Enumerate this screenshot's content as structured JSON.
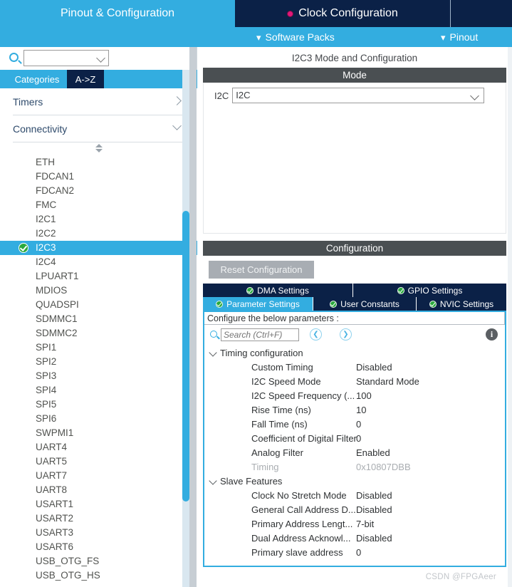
{
  "header": {
    "tabs": [
      {
        "label": "Pinout & Configuration",
        "active": true,
        "has_error_dot": false
      },
      {
        "label": "Clock Configuration",
        "active": false,
        "has_error_dot": true
      }
    ],
    "subbar": [
      {
        "label": "Software Packs",
        "icon": "chevron-down-icon"
      },
      {
        "label": "Pinout",
        "icon": "chevron-down-icon"
      }
    ],
    "colors": {
      "active_tab": "#33ade0",
      "inactive_tab": "#0b2147",
      "error_dot": "#e0187a"
    }
  },
  "sidebar": {
    "search": {
      "value": "",
      "placeholder": "",
      "icon": "search-icon"
    },
    "settings_icon": "gear-icon",
    "category_tabs": [
      {
        "label": "Categories",
        "active": true
      },
      {
        "label": "A->Z",
        "active": false
      }
    ],
    "groups": [
      {
        "label": "Timers",
        "expanded": false,
        "icon": "chevron-right-icon"
      },
      {
        "label": "Connectivity",
        "expanded": true,
        "icon": "chevron-down-icon"
      }
    ],
    "peripherals": [
      {
        "label": "ETH",
        "selected": false,
        "configured": false
      },
      {
        "label": "FDCAN1",
        "selected": false,
        "configured": false
      },
      {
        "label": "FDCAN2",
        "selected": false,
        "configured": false
      },
      {
        "label": "FMC",
        "selected": false,
        "configured": false
      },
      {
        "label": "I2C1",
        "selected": false,
        "configured": false
      },
      {
        "label": "I2C2",
        "selected": false,
        "configured": false
      },
      {
        "label": "I2C3",
        "selected": true,
        "configured": true
      },
      {
        "label": "I2C4",
        "selected": false,
        "configured": false
      },
      {
        "label": "LPUART1",
        "selected": false,
        "configured": false
      },
      {
        "label": "MDIOS",
        "selected": false,
        "configured": false
      },
      {
        "label": "QUADSPI",
        "selected": false,
        "configured": false
      },
      {
        "label": "SDMMC1",
        "selected": false,
        "configured": false
      },
      {
        "label": "SDMMC2",
        "selected": false,
        "configured": false
      },
      {
        "label": "SPI1",
        "selected": false,
        "configured": false
      },
      {
        "label": "SPI2",
        "selected": false,
        "configured": false
      },
      {
        "label": "SPI3",
        "selected": false,
        "configured": false
      },
      {
        "label": "SPI4",
        "selected": false,
        "configured": false
      },
      {
        "label": "SPI5",
        "selected": false,
        "configured": false
      },
      {
        "label": "SPI6",
        "selected": false,
        "configured": false
      },
      {
        "label": "SWPMI1",
        "selected": false,
        "configured": false
      },
      {
        "label": "UART4",
        "selected": false,
        "configured": false
      },
      {
        "label": "UART5",
        "selected": false,
        "configured": false
      },
      {
        "label": "UART7",
        "selected": false,
        "configured": false
      },
      {
        "label": "UART8",
        "selected": false,
        "configured": false
      },
      {
        "label": "USART1",
        "selected": false,
        "configured": false
      },
      {
        "label": "USART2",
        "selected": false,
        "configured": false
      },
      {
        "label": "USART3",
        "selected": false,
        "configured": false
      },
      {
        "label": "USART6",
        "selected": false,
        "configured": false
      },
      {
        "label": "USB_OTG_FS",
        "selected": false,
        "configured": false
      },
      {
        "label": "USB_OTG_HS",
        "selected": false,
        "configured": false
      }
    ]
  },
  "main": {
    "title": "I2C3 Mode and Configuration",
    "mode": {
      "header": "Mode",
      "field_label": "I2C",
      "selected_value": "I2C"
    },
    "configuration": {
      "header": "Configuration",
      "reset_button": "Reset Configuration",
      "tabs_row1": [
        {
          "label": "DMA Settings",
          "active": false,
          "icon": "check-circle-icon"
        },
        {
          "label": "GPIO Settings",
          "active": false,
          "icon": "check-circle-icon"
        }
      ],
      "tabs_row2": [
        {
          "label": "Parameter Settings",
          "active": true,
          "icon": "check-circle-icon"
        },
        {
          "label": "User Constants",
          "active": false,
          "icon": "check-circle-icon"
        },
        {
          "label": "NVIC Settings",
          "active": false,
          "icon": "check-circle-icon"
        }
      ],
      "configure_hint": "Configure the below parameters :",
      "search": {
        "value": "",
        "placeholder": "Search (Ctrl+F)",
        "icon": "search-icon"
      },
      "nav_prev_icon": "chevron-left-circle-icon",
      "nav_next_icon": "chevron-right-circle-icon",
      "info_icon": "info-icon",
      "groups": [
        {
          "label": "Timing configuration",
          "expanded": true,
          "params": [
            {
              "name": "Custom Timing",
              "value": "Disabled",
              "dim": false
            },
            {
              "name": "I2C Speed Mode",
              "value": "Standard Mode",
              "dim": false
            },
            {
              "name": "I2C Speed Frequency (...",
              "value": "100",
              "dim": false
            },
            {
              "name": "Rise Time (ns)",
              "value": "10",
              "dim": false
            },
            {
              "name": "Fall Time (ns)",
              "value": "0",
              "dim": false
            },
            {
              "name": "Coefficient of Digital Filter",
              "value": "0",
              "dim": false
            },
            {
              "name": "Analog Filter",
              "value": "Enabled",
              "dim": false
            },
            {
              "name": "Timing",
              "value": "0x10807DBB",
              "dim": true
            }
          ]
        },
        {
          "label": "Slave Features",
          "expanded": true,
          "params": [
            {
              "name": "Clock No Stretch Mode",
              "value": "Disabled",
              "dim": false
            },
            {
              "name": "General Call Address D...",
              "value": "Disabled",
              "dim": false
            },
            {
              "name": "Primary Address Lengt...",
              "value": "7-bit",
              "dim": false
            },
            {
              "name": "Dual Address Acknowl...",
              "value": "Disabled",
              "dim": false
            },
            {
              "name": "Primary slave address",
              "value": "0",
              "dim": false
            }
          ]
        }
      ]
    }
  },
  "watermark": "CSDN @FPGAeer"
}
